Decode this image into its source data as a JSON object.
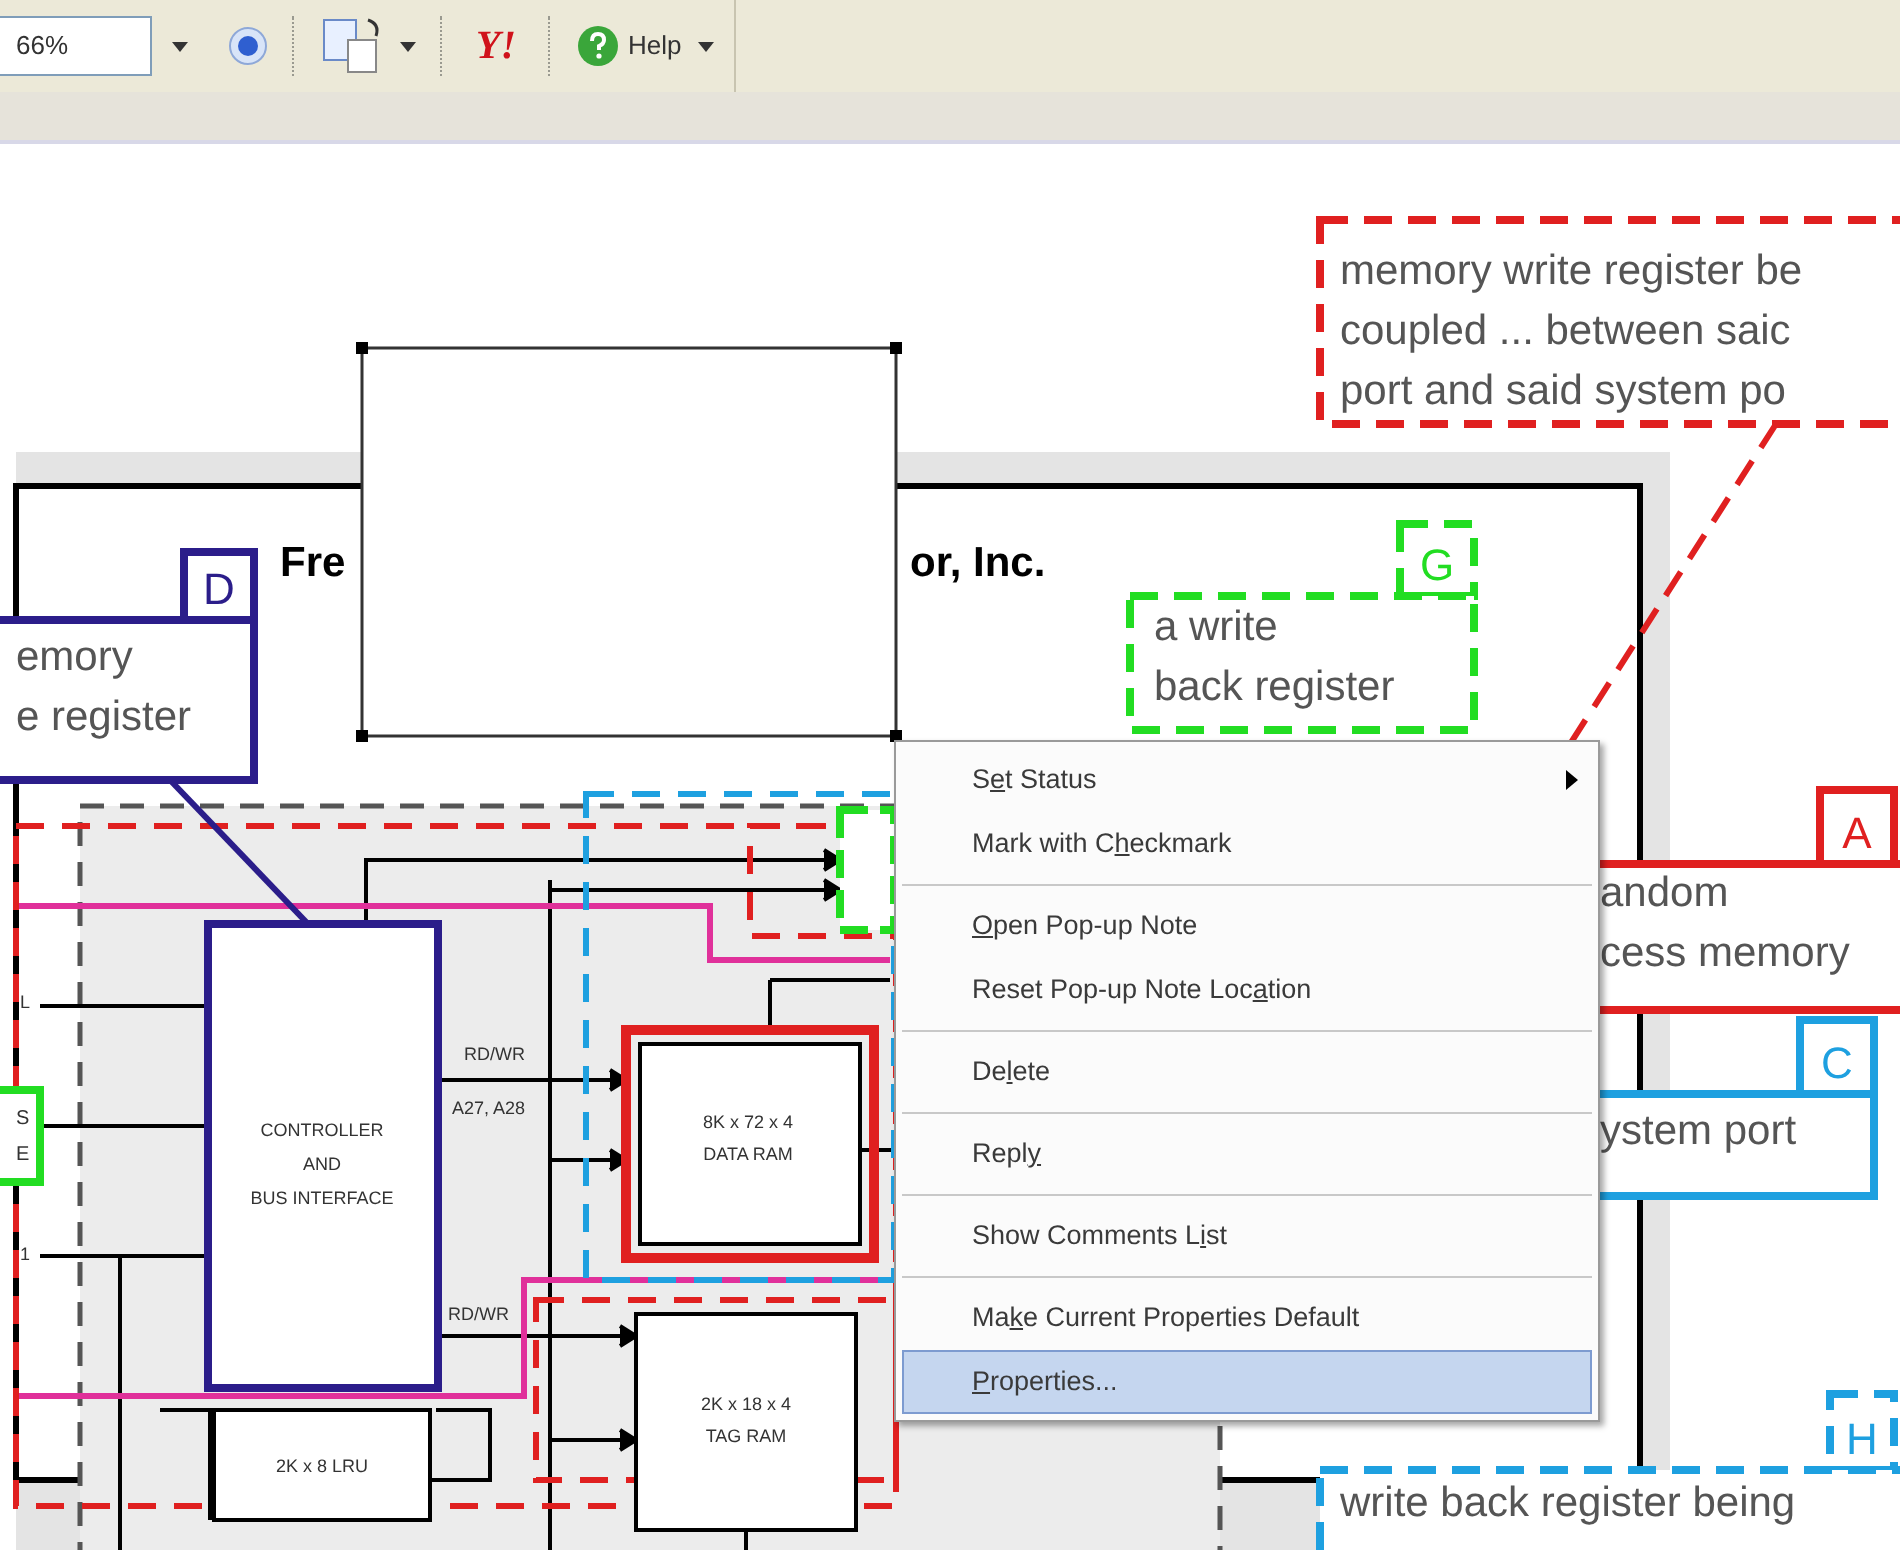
{
  "toolbar": {
    "zoom_field": {
      "value": "66%"
    },
    "logo_text": "Y!",
    "help_button": {
      "label": "Help"
    }
  },
  "document": {
    "title_left": "Fre",
    "title_right": "or, Inc.",
    "callouts": [
      {
        "letter": "D",
        "lines": [
          "emory",
          "e register"
        ],
        "color": "#2b1d8a",
        "kind": "solid"
      },
      {
        "letter": "G",
        "lines": [
          "a write",
          "back register"
        ],
        "color": "#22dd22",
        "kind": "dashed"
      },
      {
        "lines": [
          "memory write register be",
          "coupled ... between saic",
          "port and said system po"
        ],
        "color": "#e02020",
        "kind": "dashed"
      },
      {
        "letter": "A",
        "lines": [
          "andom",
          "cess memory"
        ],
        "color": "#e02020",
        "kind": "solid"
      },
      {
        "letter": "C",
        "lines": [
          "ystem port"
        ],
        "color": "#1ea0e0",
        "kind": "solid"
      },
      {
        "letter": "H",
        "lines": [
          "write back register being"
        ],
        "color": "#1ea0e0",
        "kind": "dashed"
      }
    ],
    "blocks": [
      {
        "lines": [
          "CONTROLLER",
          "AND",
          "BUS INTERFACE"
        ]
      },
      {
        "lines": [
          "8K x 72 x 4",
          "DATA RAM"
        ]
      },
      {
        "lines": [
          "2K x 18 x 4",
          "TAG RAM"
        ]
      },
      {
        "lines": [
          "2K x 8 LRU"
        ]
      }
    ],
    "signal_labels": [
      "RD/WR",
      "A27, A28",
      "RD/WR",
      "L",
      "1"
    ],
    "side_box_lines": [
      "S",
      "E"
    ]
  },
  "context_menu": {
    "groups": [
      [
        {
          "before": "S",
          "key": "e",
          "after": "t Status",
          "submenu": true,
          "selected": false
        },
        {
          "before": "Mark with C",
          "key": "h",
          "after": "eckmark",
          "submenu": false,
          "selected": false
        }
      ],
      [
        {
          "key": "O",
          "after": "pen Pop-up Note",
          "submenu": false,
          "selected": false
        },
        {
          "before": "Reset Pop-up Note Loc",
          "key": "a",
          "after": "tion",
          "submenu": false,
          "selected": false
        }
      ],
      [
        {
          "before": "De",
          "key": "l",
          "after": "ete",
          "submenu": false,
          "selected": false
        }
      ],
      [
        {
          "before": "Repl",
          "key": "y",
          "submenu": false,
          "selected": false
        }
      ],
      [
        {
          "before": "Show Comments L",
          "key": "i",
          "after": "st",
          "submenu": false,
          "selected": false
        }
      ],
      [
        {
          "before": "Ma",
          "key": "k",
          "after": "e Current Properties Default",
          "submenu": false,
          "selected": false
        },
        {
          "key": "P",
          "after": "roperties...",
          "submenu": false,
          "selected": true
        }
      ]
    ]
  }
}
